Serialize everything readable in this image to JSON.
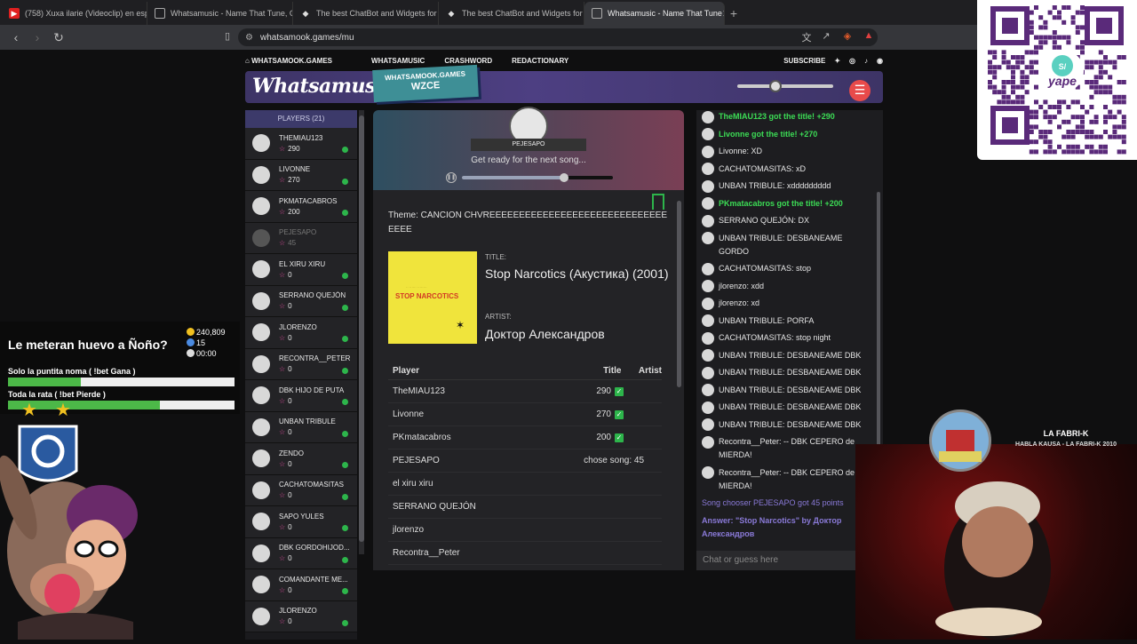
{
  "browser": {
    "tabs": [
      {
        "label": "(758) Xuxa ilarie (Videoclip) en españ",
        "icon": "youtube-icon"
      },
      {
        "label": "Whatsamusic - Name That Tune, Gue",
        "icon": "site-icon"
      },
      {
        "label": "The best ChatBot and Widgets for Ki",
        "icon": "botrix-icon"
      },
      {
        "label": "The best ChatBot and Widgets for Ki",
        "icon": "botrix-icon"
      },
      {
        "label": "Whatsamusic - Name That Tune",
        "icon": "site-icon"
      }
    ],
    "url": "whatsamook.games/mu",
    "new_tab": "+"
  },
  "sitenav": {
    "home": "WHATSAMOOK.GAMES",
    "links": [
      "WHATSAMUSIC",
      "CRASHWORD",
      "REDACTIONARY"
    ],
    "subscribe": "SUBSCRIBE"
  },
  "header": {
    "logo": "Whatsamusic",
    "badge_top": "WHATSAMOOK.GAMES",
    "badge_code": "WZCE"
  },
  "players": {
    "heading": "PLAYERS (21)",
    "list": [
      {
        "name": "THEMIAU123",
        "score": "290"
      },
      {
        "name": "LIVONNE",
        "score": "270"
      },
      {
        "name": "PKMATACABROS",
        "score": "200"
      },
      {
        "name": "PEJESAPO",
        "score": "45"
      },
      {
        "name": "EL XIRU XIRU",
        "score": "0"
      },
      {
        "name": "SERRANO QUEJÓN",
        "score": "0"
      },
      {
        "name": "JLORENZO",
        "score": "0"
      },
      {
        "name": "RECONTRA__PETER",
        "score": "0"
      },
      {
        "name": "DBK HIJO DE PUTA",
        "score": "0"
      },
      {
        "name": "UNBAN TRIBULE",
        "score": "0"
      },
      {
        "name": "ZENDO",
        "score": "0"
      },
      {
        "name": "CACHATOMASITAS",
        "score": "0"
      },
      {
        "name": "SAPO YULES",
        "score": "0"
      },
      {
        "name": "DBK GORDOHIJOD...",
        "score": "0"
      },
      {
        "name": "COMANDANTE ME...",
        "score": "0"
      },
      {
        "name": "JLORENZO",
        "score": "0"
      }
    ]
  },
  "song": {
    "chooser": "PEJESAPO",
    "status": "Get ready for the next song...",
    "progress": 0.68,
    "theme": "Theme: CANCION CHVREEEEEEEEEEEEEEEEEEEEEEEEEEEEEEEEEE",
    "title_label": "TITLE:",
    "title": "Stop Narcotics (Акустика) (2001)",
    "artist_label": "ARTIST:",
    "artist": "Доктор Александров",
    "cover_text": "STOP NARCOTICS",
    "results_headers": [
      "Player",
      "Title",
      "Artist"
    ],
    "results": [
      {
        "player": "TheMIAU123",
        "title": "290"
      },
      {
        "player": "Livonne",
        "title": "270"
      },
      {
        "player": "PKmatacabros",
        "title": "200"
      },
      {
        "player": "PEJESAPO",
        "note": "chose song: 45"
      },
      {
        "player": "el xiru xiru"
      },
      {
        "player": "SERRANO QUEJÓN"
      },
      {
        "player": "jlorenzo"
      },
      {
        "player": "Recontra__Peter"
      }
    ]
  },
  "chat": {
    "messages": [
      {
        "text": "TheMIAU123 got the title! +290",
        "style": "green"
      },
      {
        "text": "Livonne got the title! +270",
        "style": "green"
      },
      {
        "text": "Livonne: XD",
        "style": "normal"
      },
      {
        "text": "CACHATOMASITAS: xD",
        "style": "normal"
      },
      {
        "text": "UNBAN TRIBULE: xddddddddd",
        "style": "normal"
      },
      {
        "text": "PKmatacabros got the title! +200",
        "style": "green"
      },
      {
        "text": "SERRANO QUEJÓN: DX",
        "style": "normal"
      },
      {
        "text": "UNBAN TRIBULE: DESBANEAME GORDO",
        "style": "normal"
      },
      {
        "text": "CACHATOMASITAS: stop",
        "style": "normal"
      },
      {
        "text": "jlorenzo: xdd",
        "style": "normal"
      },
      {
        "text": "jlorenzo: xd",
        "style": "normal"
      },
      {
        "text": "UNBAN TRIBULE: PORFA",
        "style": "normal"
      },
      {
        "text": "CACHATOMASITAS: stop night",
        "style": "normal"
      },
      {
        "text": "UNBAN TRIBULE: DESBANEAME DBK",
        "style": "normal"
      },
      {
        "text": "UNBAN TRIBULE: DESBANEAME DBK",
        "style": "normal"
      },
      {
        "text": "UNBAN TRIBULE: DESBANEAME DBK",
        "style": "normal"
      },
      {
        "text": "UNBAN TRIBULE: DESBANEAME DBK",
        "style": "normal"
      },
      {
        "text": "UNBAN TRIBULE: DESBANEAME DBK",
        "style": "normal"
      },
      {
        "text": "Recontra__Peter: -- DBK CEPERO de MIERDA!",
        "style": "normal"
      },
      {
        "text": "Recontra__Peter: -- DBK CEPERO de MIERDA!",
        "style": "normal"
      },
      {
        "text": "Song chooser PEJESAPO got 45 points",
        "style": "sys"
      },
      {
        "text": "Answer: \"Stop Narcotics\" by Доктор Александров",
        "style": "sysb"
      }
    ],
    "input_placeholder": "Chat or guess here"
  },
  "overlay": {
    "poll_question": "Le meteran huevo a Ñoño?",
    "points": "240,809",
    "users": "15",
    "timer": "00:00",
    "option1": "Solo la puntita noma ( !bet Gana )",
    "option1_share": 0.32,
    "option2": "Toda la rata ( !bet Pierde )",
    "option2_share": 0.67,
    "dj_name": "LA FABRI-K",
    "dj_sub": "HABLA KAUSA - LA FABRI-K 2010",
    "qr_label": "yape",
    "qr_currency": "S/"
  },
  "colors": {
    "accent_green": "#2db54b",
    "star_pink": "#e04ea0",
    "header_purple": "#4d3f82"
  }
}
